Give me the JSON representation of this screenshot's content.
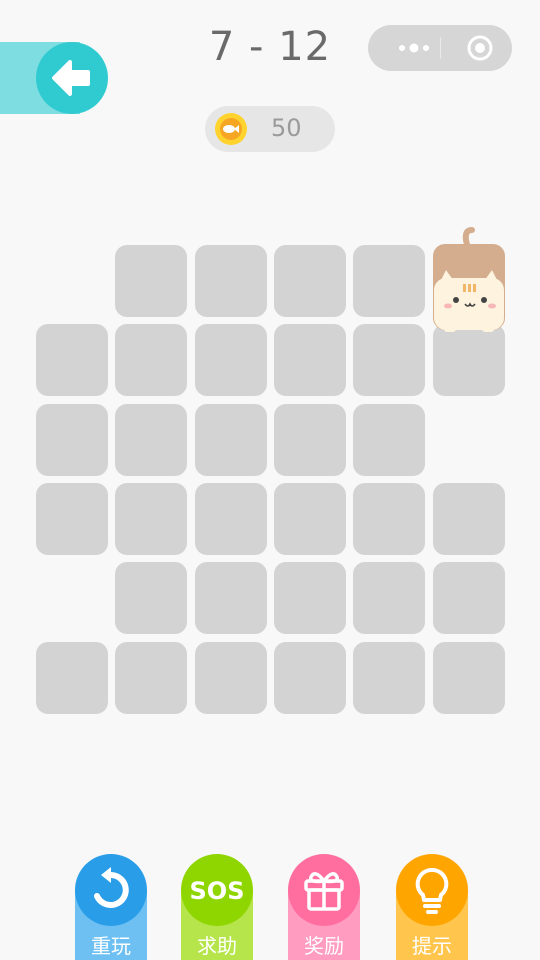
{
  "header": {
    "level": "7 - 12",
    "capsule": {
      "more_icon": "more-dots-icon",
      "close_icon": "target-circle-icon"
    },
    "back_icon": "arrow-left-icon"
  },
  "coins": {
    "count": "50",
    "icon": "fish-coin-icon"
  },
  "board": {
    "columns": 6,
    "rows": 6,
    "layout": [
      [
        0,
        1,
        1,
        1,
        1,
        2
      ],
      [
        1,
        1,
        1,
        1,
        1,
        1
      ],
      [
        1,
        1,
        1,
        1,
        1,
        0
      ],
      [
        1,
        1,
        1,
        1,
        1,
        1
      ],
      [
        0,
        1,
        1,
        1,
        1,
        1
      ],
      [
        1,
        1,
        1,
        1,
        1,
        1
      ]
    ],
    "cat_position": {
      "row": 0,
      "col": 5
    }
  },
  "buttons": [
    {
      "id": "replay",
      "label": "重玩",
      "color": "#2a9de8",
      "base": "#6ec0f3",
      "icon": "replay-icon"
    },
    {
      "id": "help",
      "label": "求助",
      "color": "#8fd600",
      "base": "#b5e54b",
      "icon": "sos-icon"
    },
    {
      "id": "reward",
      "label": "奖励",
      "color": "#ff6e9f",
      "base": "#ff9cbf",
      "icon": "gift-icon"
    },
    {
      "id": "hint",
      "label": "提示",
      "color": "#ffa500",
      "base": "#ffc54d",
      "icon": "bulb-icon"
    }
  ],
  "colors": {
    "background": "#f8f8f8",
    "tile": "#d3d3d3",
    "accent": "#2fcbd1"
  }
}
